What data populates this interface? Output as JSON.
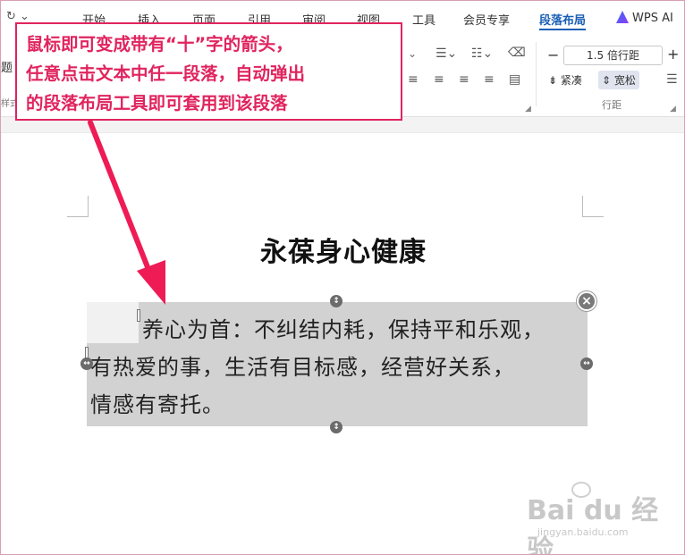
{
  "menu": {
    "quick_access": "↻ ⌄",
    "tabs": [
      "开始",
      "插入",
      "页面",
      "引用",
      "审阅",
      "视图",
      "工具",
      "会员专享",
      "段落布局",
      "WPS AI"
    ],
    "active_tab": "段落布局"
  },
  "ribbon": {
    "left_partial_1": "题",
    "left_partial_2": "样式",
    "line_spacing_value": "1.5 倍行距",
    "tight_label": "紧凑",
    "loose_label": "宽松",
    "group_label": "行距",
    "minus": "−",
    "plus": "+"
  },
  "document": {
    "title": "永葆身心健康",
    "paragraph_lines": [
      "养心为首：不纠结内耗，保持平和乐观，",
      "有热爱的事，生活有目标感，经营好关系，",
      "情感有寄托。"
    ]
  },
  "callout": {
    "lines": [
      "鼠标即可变成带有“十”字的箭头，",
      "任意点击文本中任一段落，自动弹出",
      "的段落布局工具即可套用到该段落"
    ],
    "color": "#e0245e"
  },
  "watermark": {
    "text": "Bai du 经验",
    "sub": "jingyan.baidu.com"
  }
}
